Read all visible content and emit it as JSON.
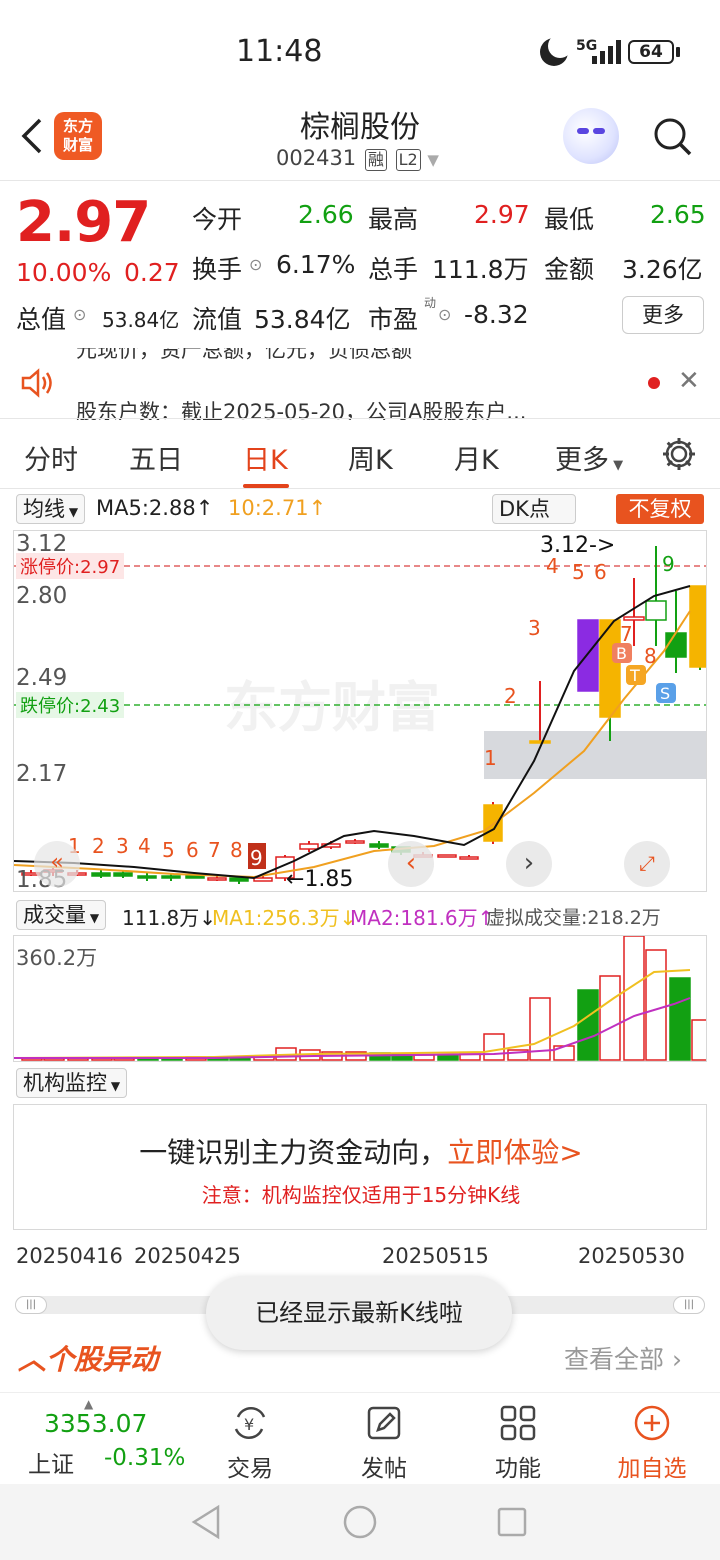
{
  "status": {
    "time": "11:48",
    "network": "5G",
    "battery": "64"
  },
  "header": {
    "name": "棕榈股份",
    "code": "002431",
    "tag1": "融",
    "tag2": "L2",
    "logo_line1": "东方",
    "logo_line2": "财富"
  },
  "quote": {
    "price": "2.97",
    "change_pct": "10.00%",
    "change": "0.27",
    "open_label": "今开",
    "open": "2.66",
    "high_label": "最高",
    "high": "2.97",
    "low_label": "最低",
    "low": "2.65",
    "turnover_label": "换手",
    "turnover": "6.17%",
    "volume_label": "总手",
    "volume": "111.8万",
    "amount_label": "金额",
    "amount": "3.26亿",
    "mktcap_label": "总值",
    "mktcap": "53.84亿",
    "float_label": "流值",
    "float": "53.84亿",
    "pe_label": "市盈",
    "pe_sup": "动",
    "pe": "-8.32",
    "more": "更多"
  },
  "notice": {
    "prev": "元现价，资产总额，亿元，负债总额",
    "text": "股东户数：截止2025-05-20，公司A股股东户..."
  },
  "tabs": [
    "分时",
    "五日",
    "日K",
    "周K",
    "月K",
    "更多"
  ],
  "indicator": {
    "label": "均线",
    "ma5": "MA5:2.88",
    "ma10": "10:2.71",
    "dk": "DK点",
    "fq": "不复权"
  },
  "kchart": {
    "y_labels": [
      "3.12",
      "2.80",
      "2.49",
      "2.17",
      "1.85"
    ],
    "limit_up": "涨停价:2.97",
    "limit_down": "跌停价:2.43",
    "high_mark": "3.12->",
    "low_mark": "1.85",
    "watermark": "东方财富"
  },
  "volume": {
    "label": "成交量",
    "value": "111.8万",
    "ma1": "MA1:256.3万",
    "ma2": "MA2:181.6万",
    "virtual": "虚拟成交量:218.2万",
    "y_label": "360.2万"
  },
  "monitor": {
    "label": "机构监控",
    "headline": "一键识别主力资金动向，",
    "cta": "立即体验>",
    "note": "注意：机构监控仅适用于15分钟K线"
  },
  "dates": [
    "20250416",
    "20250425",
    "20250515",
    "20250530"
  ],
  "toast": "已经显示最新K线啦",
  "movers": {
    "title": "个股异动",
    "view_all": "查看全部"
  },
  "bottom_nav": {
    "index_value": "3353.07",
    "index_name": "上证",
    "index_change": "-0.31%",
    "trade": "交易",
    "post": "发帖",
    "func": "功能",
    "add": "加自选"
  },
  "colors": {
    "up": "#e02020",
    "down": "#12a012",
    "accent": "#e3431b",
    "ma5": "#111111",
    "ma10": "#f0a020"
  }
}
